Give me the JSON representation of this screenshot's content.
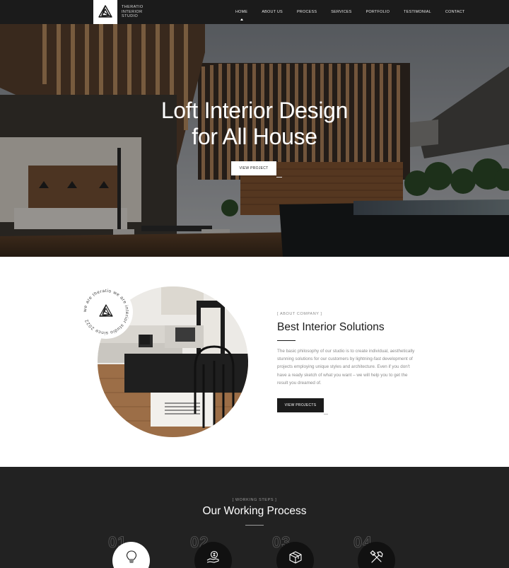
{
  "header": {
    "logo_lines": [
      "THERATIO",
      "INTERIOR",
      "STUDIO"
    ],
    "nav": [
      "HOME",
      "ABOUT US",
      "PROCESS",
      "SERVICES",
      "PORTFOLIO",
      "TESTIMONIAL",
      "CONTACT"
    ],
    "active_nav": "HOME"
  },
  "hero": {
    "title_line1": "Loft Interior Design",
    "title_line2": "for All House",
    "button_label": "VIEW PROJECT"
  },
  "about": {
    "stamp_text": "we are theratio we are interior studio since 2022",
    "eyebrow": "[ ABOUT COMPANY ]",
    "title": "Best Interior Solutions",
    "body": "The basic philosophy of our studio is to create individual, aesthetically stunning solutions for our customers by lightning-fast development of projects employing unique styles and architecture. Even if you don't have a ready sketch of what you want – we will help you to get the result you dreamed of.",
    "button_label": "VIEW PROJECTS"
  },
  "process": {
    "eyebrow": "[ WORKING STEPS ]",
    "title": "Our Working Process",
    "steps": [
      {
        "num": "01",
        "icon": "lightbulb-icon",
        "active": true
      },
      {
        "num": "02",
        "icon": "money-hand-icon",
        "active": false
      },
      {
        "num": "03",
        "icon": "box-3d-icon",
        "active": false
      },
      {
        "num": "04",
        "icon": "tools-icon",
        "active": false
      }
    ]
  },
  "colors": {
    "header_bg": "#1b1b1b",
    "dark_section_bg": "#222222",
    "accent_dark": "#1b1b1b",
    "body_text": "#8a8a8a"
  }
}
